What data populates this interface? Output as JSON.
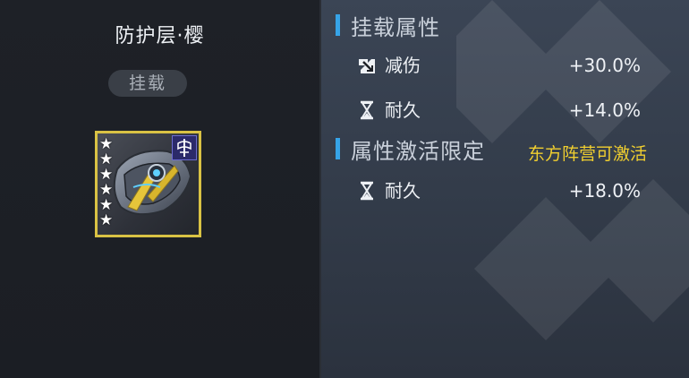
{
  "item": {
    "name": "防护层·樱",
    "equip_tag": "挂载",
    "stars": [
      "★",
      "★",
      "★",
      "★",
      "★",
      "★"
    ]
  },
  "sections": {
    "equip_attributes": {
      "title": "挂载属性",
      "stats": [
        {
          "icon": "damage-reduction-icon",
          "name": "减伤",
          "value": "+30.0%"
        },
        {
          "icon": "hourglass-icon",
          "name": "耐久",
          "value": "+14.0%"
        }
      ]
    },
    "restricted_attributes": {
      "title": "属性激活限定",
      "activation_note": "东方阵营可激活",
      "stats": [
        {
          "icon": "hourglass-icon",
          "name": "耐久",
          "value": "+18.0%"
        }
      ]
    }
  },
  "colors": {
    "accent_blue": "#36a4e8",
    "gold_frame": "#d9c244",
    "note_yellow": "#f1cf2f"
  }
}
